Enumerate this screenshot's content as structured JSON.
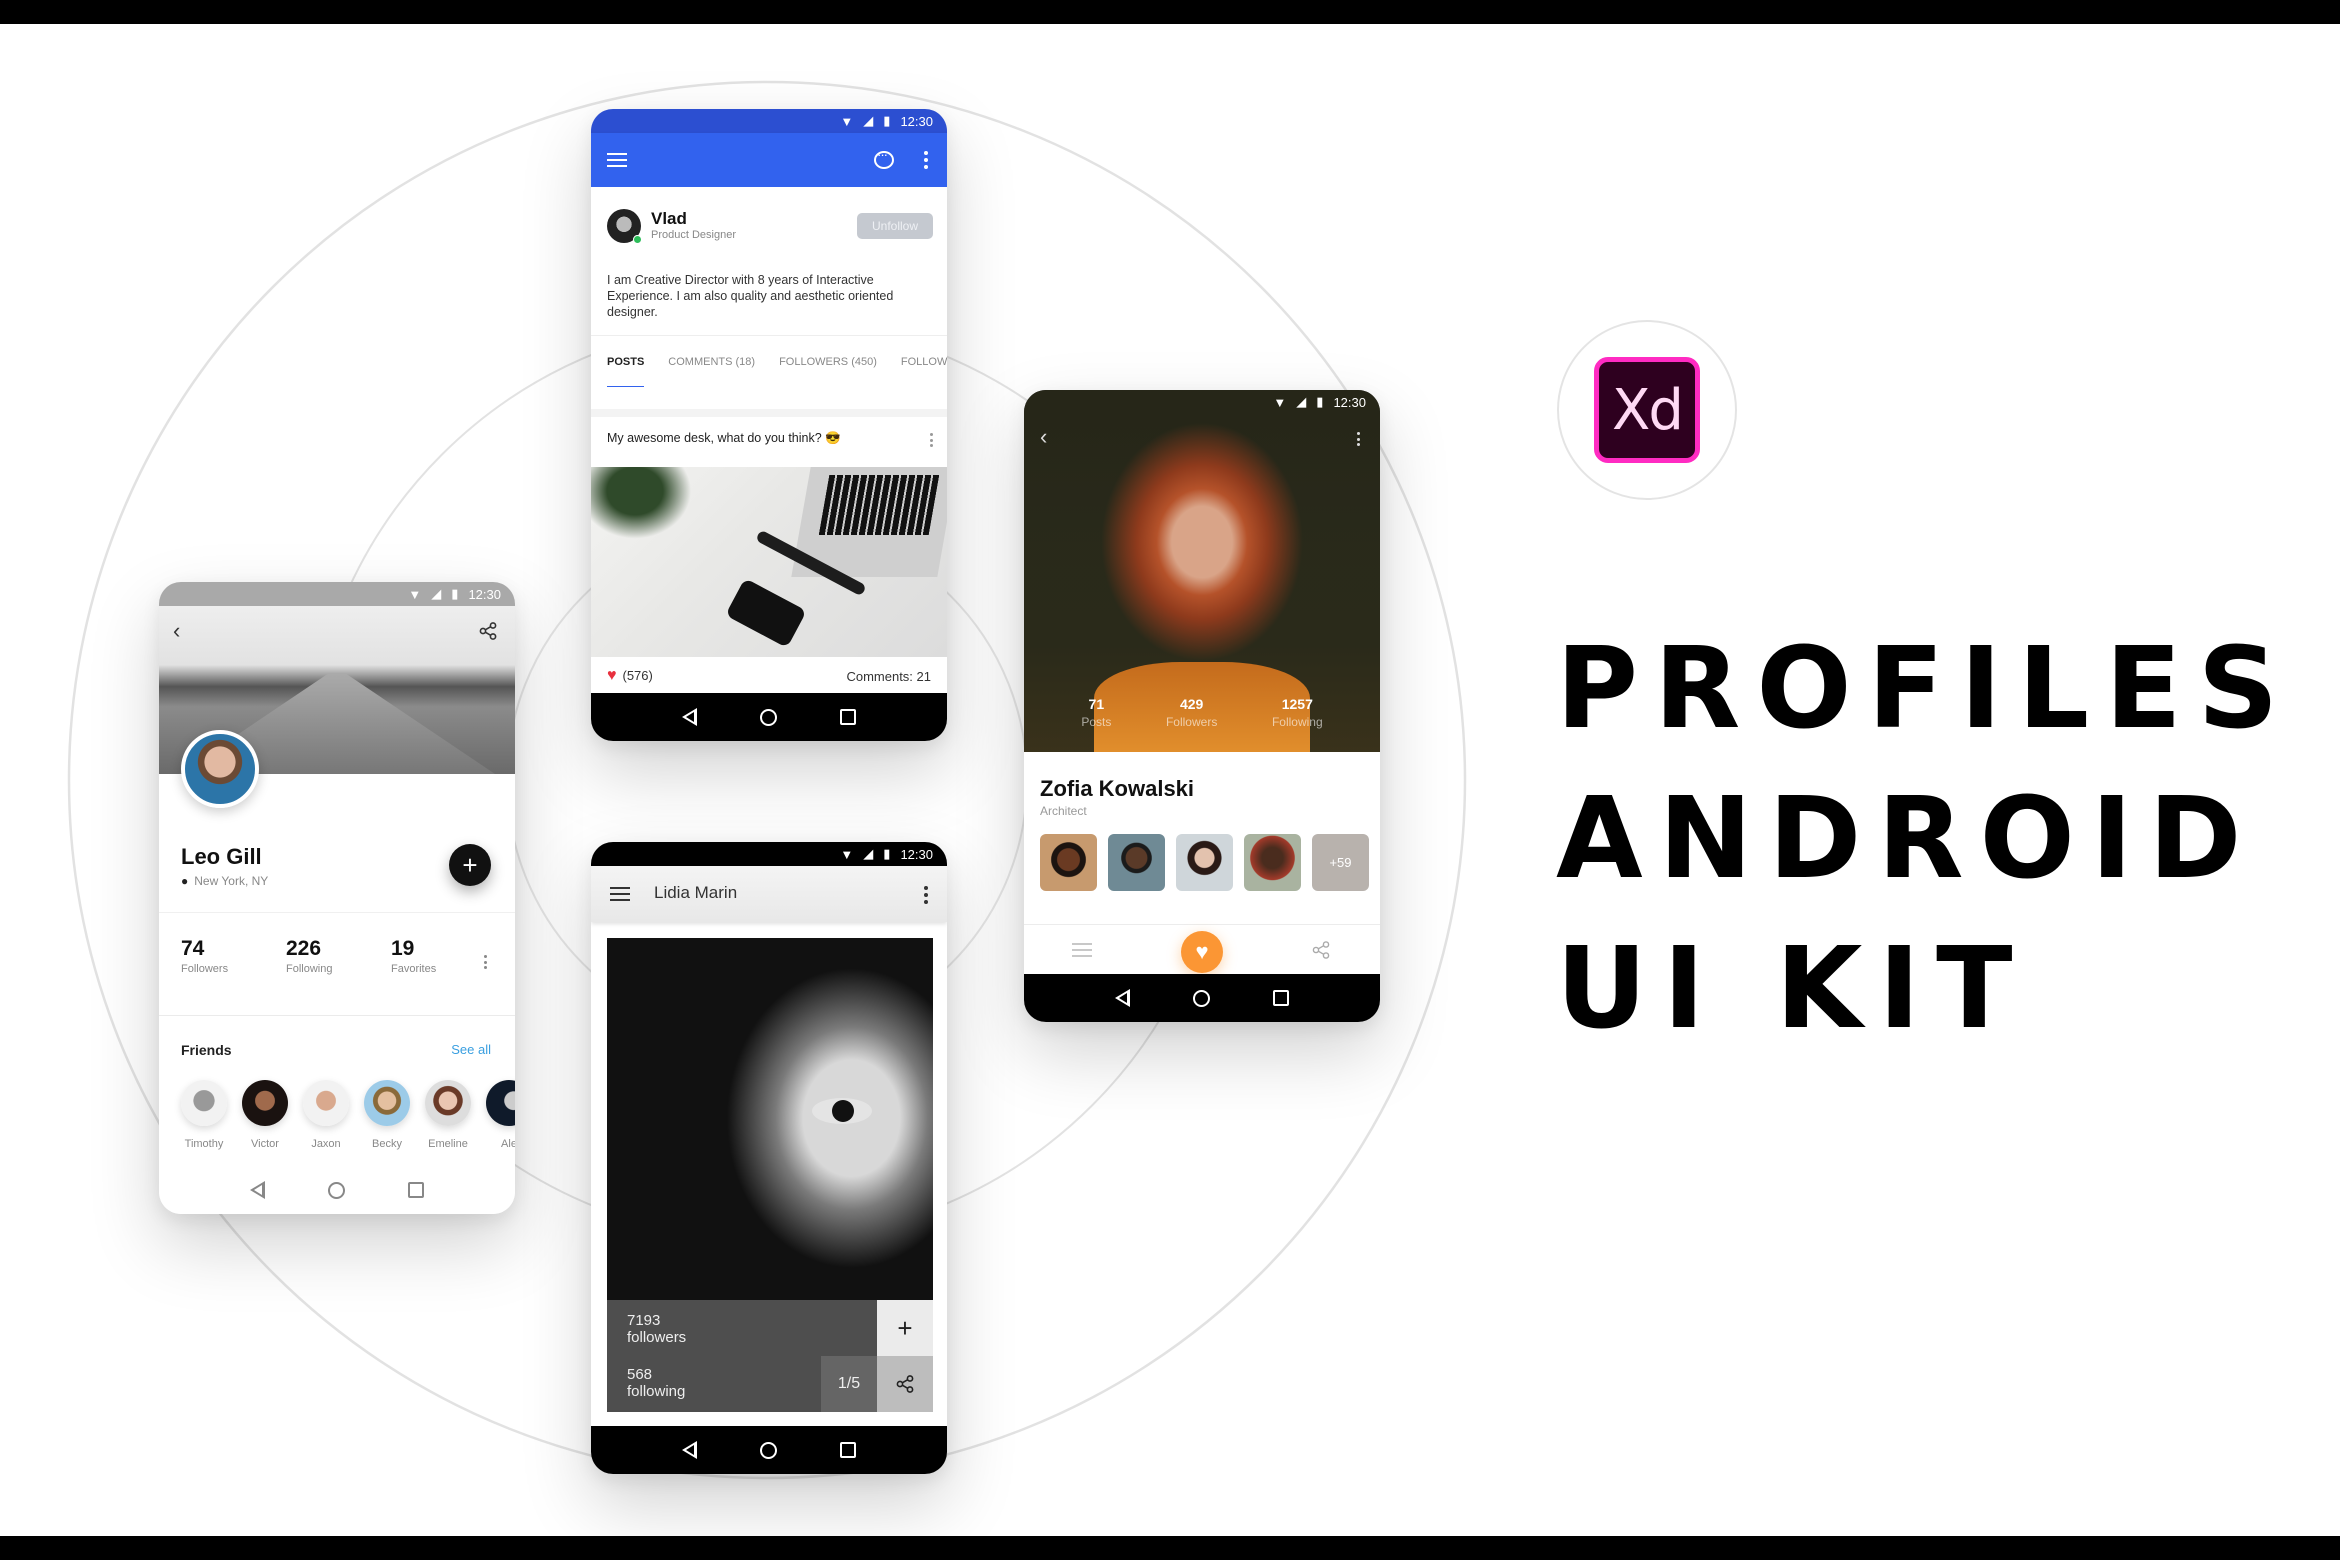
{
  "status_time": "12:30",
  "brand": {
    "logo_text": "Xd",
    "title_lines": [
      "PROFILES",
      "ANDROID",
      "UI KIT"
    ]
  },
  "colors": {
    "blue_appbar": "#3262ee",
    "orange_accent": "#fb9634",
    "like_red": "#e8303e",
    "link_blue": "#3a9fe0",
    "xd_pink": "#ff2bc2",
    "xd_dark": "#2e001f"
  },
  "vlad_screen": {
    "name": "Vlad",
    "role": "Product Designer",
    "unfollow_label": "Unfollow",
    "bio": "I am Creative Director with 8 years of Interactive Experience. I am also quality and aesthetic oriented designer.",
    "tabs": [
      {
        "label": "POSTS",
        "active": true
      },
      {
        "label": "COMMENTS (18)",
        "active": false
      },
      {
        "label": "FOLLOWERS (450)",
        "active": false
      },
      {
        "label": "FOLLOWING",
        "active": false
      }
    ],
    "post": {
      "caption": "My awesome desk, what do you think? 😎",
      "likes": "(576)",
      "comments": "Comments: 21"
    }
  },
  "leo_screen": {
    "name": "Leo Gill",
    "location": "New York, NY",
    "stats": [
      {
        "value": "74",
        "label": "Followers"
      },
      {
        "value": "226",
        "label": "Following"
      },
      {
        "value": "19",
        "label": "Favorites"
      }
    ],
    "friends_title": "Friends",
    "see_all": "See all",
    "friends": [
      "Timothy",
      "Victor",
      "Jaxon",
      "Becky",
      "Emeline",
      "Ale"
    ]
  },
  "lidia_screen": {
    "title": "Lidia Marin",
    "followers_value": "7193",
    "followers_label": "followers",
    "following_value": "568",
    "following_label": "following",
    "counter": "1/5"
  },
  "zofia_screen": {
    "name": "Zofia Kowalski",
    "role": "Architect",
    "stats": [
      {
        "value": "71",
        "label": "Posts"
      },
      {
        "value": "429",
        "label": "Followers"
      },
      {
        "value": "1257",
        "label": "Following"
      }
    ],
    "more_friends": "+59"
  }
}
